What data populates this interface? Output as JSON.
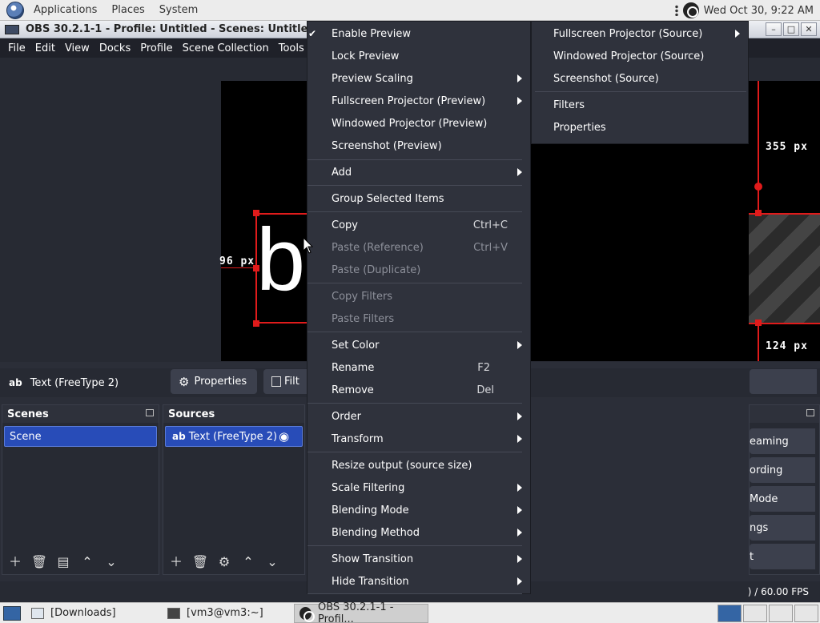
{
  "top_panel": {
    "applications": "Applications",
    "places": "Places",
    "system": "System",
    "clock": "Wed Oct 30,  9:22 AM"
  },
  "window": {
    "title": "OBS 30.2.1-1 - Profile: Untitled - Scenes: Untitled"
  },
  "menubar": [
    "File",
    "Edit",
    "View",
    "Docks",
    "Profile",
    "Scene Collection",
    "Tools"
  ],
  "preview": {
    "text_glyph": "b",
    "px_left": "96 px",
    "px_top_right": "355 px",
    "px_bottom_right": "124 px"
  },
  "source_toolbar": {
    "badge": "ab",
    "source_name": "Text (FreeType 2)",
    "properties": "Properties",
    "filters_partial": "Filt"
  },
  "scenes_dock": {
    "title": "Scenes",
    "items": [
      "Scene"
    ]
  },
  "sources_dock": {
    "title": "Sources",
    "items": [
      {
        "badge": "ab",
        "label": "Text (FreeType 2)"
      }
    ]
  },
  "controls_dock": {
    "buttons": [
      "eaming",
      "ording",
      "Mode",
      "ngs",
      "t"
    ]
  },
  "status": {
    "fps": ") / 60.00 FPS"
  },
  "context_menu": {
    "items": [
      {
        "label": "Enable Preview",
        "checked": true
      },
      {
        "label": "Lock Preview"
      },
      {
        "label": "Preview Scaling",
        "submenu": true
      },
      {
        "label": "Fullscreen Projector (Preview)",
        "submenu": true
      },
      {
        "label": "Windowed Projector (Preview)"
      },
      {
        "label": "Screenshot (Preview)"
      },
      {
        "label": "Add",
        "submenu": true
      },
      {
        "label": "Group Selected Items"
      },
      {
        "label": "Copy",
        "shortcut": "Ctrl+C"
      },
      {
        "label": "Paste (Reference)",
        "shortcut": "Ctrl+V",
        "disabled": true
      },
      {
        "label": "Paste (Duplicate)",
        "disabled": true
      },
      {
        "label": "Copy Filters",
        "disabled": true
      },
      {
        "label": "Paste Filters",
        "disabled": true
      },
      {
        "label": "Set Color",
        "submenu": true
      },
      {
        "label": "Rename",
        "shortcut": "F2"
      },
      {
        "label": "Remove",
        "shortcut": "Del"
      },
      {
        "label": "Order",
        "submenu": true
      },
      {
        "label": "Transform",
        "submenu": true
      },
      {
        "label": "Resize output (source size)"
      },
      {
        "label": "Scale Filtering",
        "submenu": true
      },
      {
        "label": "Blending Mode",
        "submenu": true
      },
      {
        "label": "Blending Method",
        "submenu": true
      },
      {
        "label": "Show Transition",
        "submenu": true
      },
      {
        "label": "Hide Transition",
        "submenu": true
      }
    ]
  },
  "submenu": {
    "items": [
      {
        "label": "Fullscreen Projector (Source)",
        "submenu": true
      },
      {
        "label": "Windowed Projector (Source)"
      },
      {
        "label": "Screenshot (Source)"
      },
      {
        "label": "Filters"
      },
      {
        "label": "Properties"
      }
    ]
  },
  "taskbar": {
    "tasks": [
      "[Downloads]",
      "[vm3@vm3:~]",
      "OBS 30.2.1-1 - Profil..."
    ]
  },
  "colors": {
    "accent_selection": "#284cb8",
    "transform_red": "#e01b1b",
    "menu_bg": "#2f323c"
  }
}
